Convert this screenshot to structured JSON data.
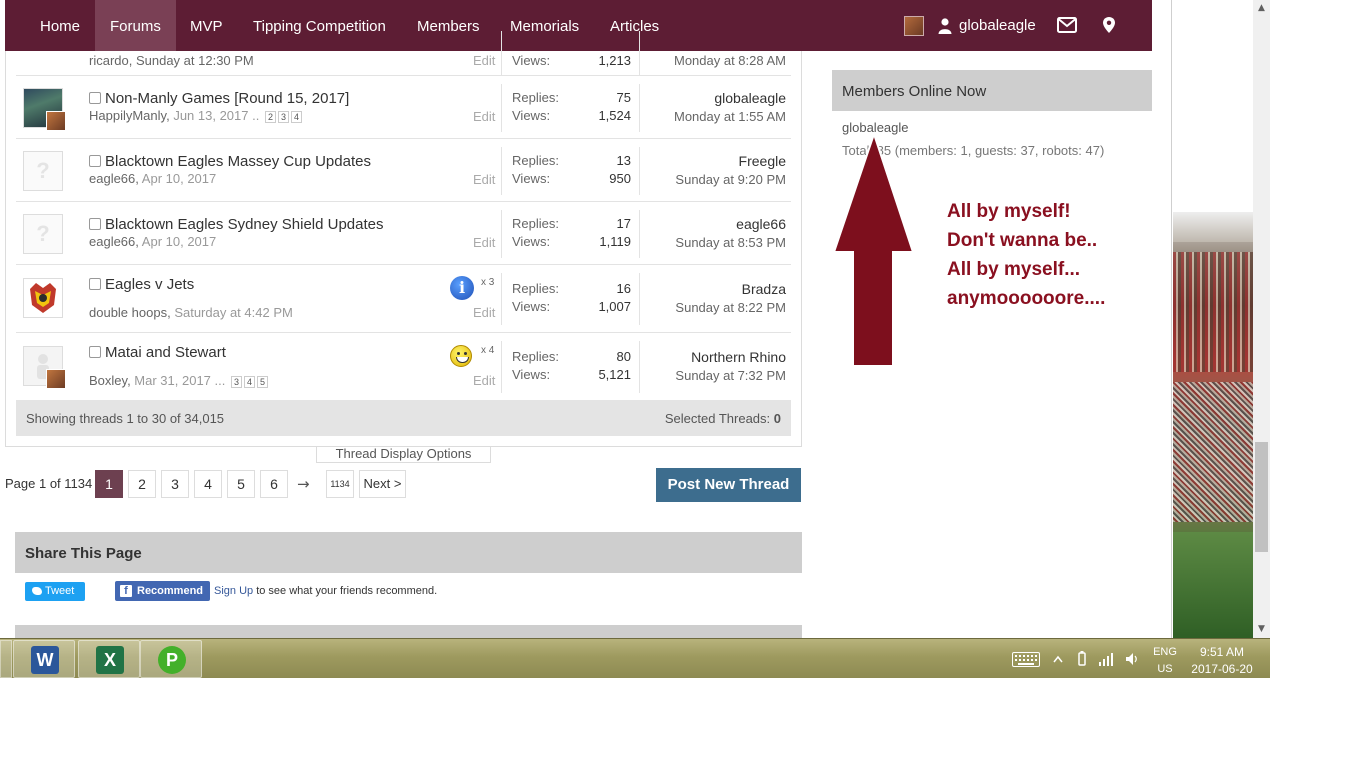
{
  "nav": {
    "items": [
      "Home",
      "Forums",
      "MVP",
      "Tipping Competition",
      "Members",
      "Memorials",
      "Articles"
    ],
    "active": "Forums",
    "username": "globaleagle"
  },
  "partial_row": {
    "meta": "ricardo, Sunday at 12:30 PM",
    "edit": "Edit",
    "views_label": "Views:",
    "views": "1,213",
    "last_date": "Monday at 8:28 AM"
  },
  "threads": [
    {
      "title": "Non-Manly Games [Round 15, 2017]",
      "author": "HappilyManly",
      "date": "Jun 13, 2017",
      "pages": [
        "2",
        "3",
        "4"
      ],
      "replies": "75",
      "views": "1,524",
      "last_user": "globaleagle",
      "last_date": "Monday at 1:55 AM"
    },
    {
      "title": "Blacktown Eagles Massey Cup Updates",
      "author": "eagle66",
      "date": "Apr 10, 2017",
      "pages": [],
      "replies": "13",
      "views": "950",
      "last_user": "Freegle",
      "last_date": "Sunday at 9:20 PM"
    },
    {
      "title": "Blacktown Eagles Sydney Shield Updates",
      "author": "eagle66",
      "date": "Apr 10, 2017",
      "pages": [],
      "replies": "17",
      "views": "1,119",
      "last_user": "eagle66",
      "last_date": "Sunday at 8:53 PM"
    },
    {
      "title": "Eagles v Jets",
      "author": "double hoops",
      "date": "Saturday at 4:42 PM",
      "pages": [],
      "prefix_count": "x 3",
      "replies": "16",
      "views": "1,007",
      "last_user": "Bradza",
      "last_date": "Sunday at 8:22 PM"
    },
    {
      "title": "Matai and Stewart",
      "author": "Boxley",
      "date": "Mar 31, 2017",
      "pages": [
        "3",
        "4",
        "5"
      ],
      "prefix_count": "x 4",
      "replies": "80",
      "views": "5,121",
      "last_user": "Northern Rhino",
      "last_date": "Sunday at 7:32 PM"
    }
  ],
  "labels": {
    "replies": "Replies:",
    "views": "Views:",
    "edit": "Edit",
    "ellipsis": "..",
    "ellipsis3": "..."
  },
  "footer": {
    "showing": "Showing threads 1 to 30 of 34,015",
    "selected_label": "Selected Threads: ",
    "selected_count": "0"
  },
  "display_options": "Thread Display Options",
  "pager": {
    "label": "Page 1 of 1134",
    "pages": [
      "1",
      "2",
      "3",
      "4",
      "5",
      "6"
    ],
    "arrow": "→",
    "last": "1134",
    "next": "Next >"
  },
  "post_new": "Post New Thread",
  "share": {
    "title": "Share This Page",
    "tweet": "Tweet",
    "recommend": "Recommend",
    "fb_icon": "f",
    "signup": "Sign Up",
    "fb_text": " to see what your friends recommend."
  },
  "online": {
    "title": "Members Online Now",
    "user": "globaleagle",
    "total": "Total: 85 (members: 1, guests: 37, robots: 47)"
  },
  "annotation": [
    "All by myself!",
    "Don't wanna be..",
    "All by myself...",
    "anymoooooore...."
  ],
  "taskbar": {
    "apps": [
      {
        "name": "word",
        "glyph": "W",
        "color": "#2b579a"
      },
      {
        "name": "excel",
        "glyph": "X",
        "color": "#217346"
      },
      {
        "name": "vpn",
        "glyph": "P",
        "color": "#43b02a"
      }
    ],
    "lang1": "ENG",
    "lang2": "US",
    "time": "9:51 AM",
    "date": "2017-06-20"
  },
  "colors": {
    "nav_bg": "#5d1d34",
    "accent_button": "#3d6d8e",
    "annotation": "#8a1020"
  }
}
